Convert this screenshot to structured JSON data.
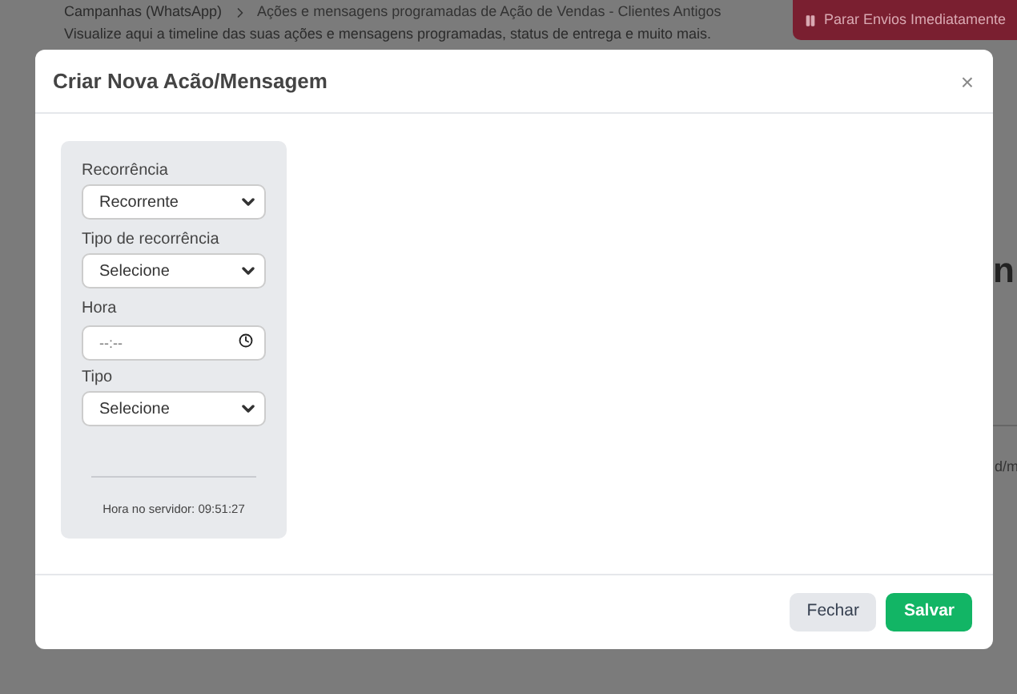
{
  "background": {
    "breadcrumb": [
      "Campanhas (WhatsApp)",
      "Ações e mensagens programadas de Ação de Vendas - Clientes Antigos"
    ],
    "subtitle": "Visualize aqui a timeline das suas ações e mensagens programadas, status de entrega e muito mais.",
    "stop_button": "Parar Envios Imediatamente",
    "heading_fragment": "n",
    "field_fragment": "d/m"
  },
  "modal": {
    "title": "Criar Nova Acão/Mensagem",
    "close": "×",
    "fields": [
      {
        "kind": "select",
        "label": "Recorrência",
        "value": "Recorrente"
      },
      {
        "kind": "select",
        "label": "Tipo de recorrência",
        "value": "Selecione"
      },
      {
        "kind": "time",
        "label": "Hora",
        "placeholder": "--:--"
      },
      {
        "kind": "select",
        "label": "Tipo",
        "value": "Selecione"
      }
    ],
    "server_time": "Hora no servidor: 09:51:27",
    "buttons": [
      {
        "label": "Fechar",
        "kind": "secondary"
      },
      {
        "label": "Salvar",
        "kind": "primary"
      }
    ]
  }
}
